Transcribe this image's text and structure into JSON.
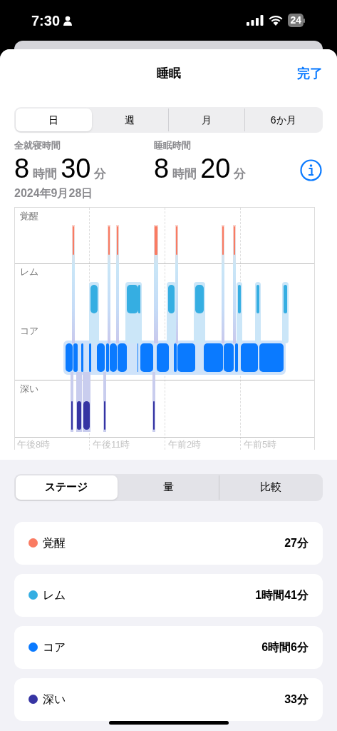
{
  "status_bar": {
    "time": "7:30",
    "battery": "24"
  },
  "header": {
    "title": "睡眠",
    "done": "完了"
  },
  "periods": [
    {
      "label": "日",
      "selected": true
    },
    {
      "label": "週",
      "selected": false
    },
    {
      "label": "月",
      "selected": false
    },
    {
      "label": "6か月",
      "selected": false
    }
  ],
  "summary": [
    {
      "label": "全就寝時間",
      "hours": "8",
      "hours_unit": "時間",
      "minutes": "30",
      "minutes_unit": "分"
    },
    {
      "label": "睡眠時間",
      "hours": "8",
      "hours_unit": "時間",
      "minutes": "20",
      "minutes_unit": "分"
    }
  ],
  "date": "2024年9月28日",
  "chart": {
    "stages": [
      "覚醒",
      "レム",
      "コア",
      "深い"
    ],
    "times": [
      "午後8時",
      "午後11時",
      "午前2時",
      "午前5時"
    ]
  },
  "views": [
    {
      "label": "ステージ",
      "selected": true
    },
    {
      "label": "量",
      "selected": false
    },
    {
      "label": "比較",
      "selected": false
    }
  ],
  "legend": [
    {
      "name": "覚醒",
      "value": "27分",
      "color": "#fa7b62"
    },
    {
      "name": "レム",
      "value": "1時間41分",
      "color": "#35aee2"
    },
    {
      "name": "コア",
      "value": "6時間6分",
      "color": "#0a7aff"
    },
    {
      "name": "深い",
      "value": "33分",
      "color": "#3634a3"
    }
  ]
}
